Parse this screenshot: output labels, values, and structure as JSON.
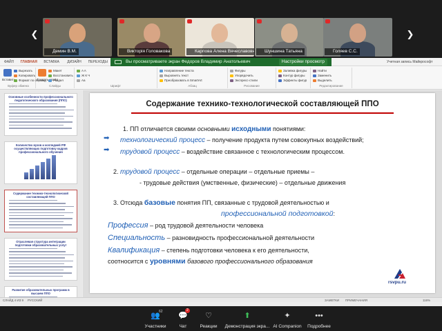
{
  "participants": [
    {
      "name": "Демин В.М.",
      "colors": {
        "bg": "#6e6a5c",
        "skin": "#d9a27a",
        "shirt": "#4a6b8c"
      }
    },
    {
      "name": "Викторія Головакова",
      "colors": {
        "bg": "#9a8a66",
        "skin": "#d8a585",
        "shirt": "#5a3c3c"
      }
    },
    {
      "name": "Карпова Алена Вячеславовна",
      "colors": {
        "bg": "#ece6da",
        "skin": "#e3b899",
        "shirt": "#c9c4bb"
      }
    },
    {
      "name": "Шуншина Татьяна",
      "colors": {
        "bg": "#8c8f86",
        "skin": "#d7b293",
        "shirt": "#6c6f70"
      }
    },
    {
      "name": "Голяев С.С.",
      "colors": {
        "bg": "#7b7f7d",
        "skin": "#d2a184",
        "shirt": "#3d4a5c"
      }
    }
  ],
  "share_banner": {
    "text": "Вы просматриваете экран Федоров Владимир Анатольевич",
    "options_label": "Настройки просмотр"
  },
  "ribbon": {
    "tabs": [
      "ФАЙЛ",
      "ГЛАВНАЯ",
      "ВСТАВКА",
      "ДИЗАЙН",
      "ПЕРЕХОДЫ",
      "АНИМАЦИЯ",
      "ПОКАЗ СЛАЙДОВ",
      "РЕЦЕНЗИРОВАНИЕ",
      "ВИД",
      "ФОРМАТ"
    ],
    "user": "Учетная запись Майкрософт",
    "groups": [
      {
        "label": "Буфер обмена",
        "items": [
          "Вырезать",
          "Копировать",
          "Формат по образцу"
        ],
        "big": "Вставить"
      },
      {
        "label": "Слайды",
        "items": [
          "Макет",
          "Восстановить",
          "Раздел"
        ],
        "big": "Создать слайд"
      },
      {
        "label": "Шрифт",
        "items": [
          "A A",
          "Ж К Ч",
          "Aa"
        ]
      },
      {
        "label": "Абзац",
        "items": [
          "Направление текста",
          "Выровнять текст",
          "Преобразовать в SmartArt"
        ]
      },
      {
        "label": "Рисование",
        "items": [
          "Фигуры",
          "Упорядочить",
          "Экспресс-стили"
        ]
      },
      {
        "label": "",
        "items": [
          "Заливка фигуры",
          "Контур фигуры",
          "Эффекты фигур"
        ]
      },
      {
        "label": "Редактирование",
        "items": [
          "Найти",
          "Заменить",
          "Выделить"
        ]
      }
    ]
  },
  "thumbnails": [
    {
      "title": "Основные особенности профессионального педагогического образования (ППО)",
      "lines": 9
    },
    {
      "title": "Количество вузов и колледжей РФ осуществляющих подготовку кадров профессионального обучения",
      "lines": 0,
      "chart": true
    },
    {
      "title": "Содержание технико-технологической составляющей ППО",
      "lines": 10,
      "selected": true
    },
    {
      "title": "Отраслевая структура интеграции подготовки образовательных услуг",
      "lines": 10
    },
    {
      "title": "Развитие образовательных программ в высшем ППО",
      "lines": 2
    }
  ],
  "slide": {
    "title": "Содержание технико-технологической составляющей ППО",
    "p1_a": "1. ПП отличается своими ",
    "p1_b": "основными",
    "p1_c": "исходными",
    "p1_d": " понятиями:",
    "p1_l1_a": "технологический процесс",
    "p1_l1_b": " – получение продукта путем совокупных воздействий;",
    "p1_l2_a": "трудовой процесс",
    "p1_l2_b": " – воздействие связанное с технологическим процессом.",
    "p2_a": "2. ",
    "p2_b": "трудовой процесс",
    "p2_c": " – отдельные операции – отдельные приемы –",
    "p2_l2": "- трудовые действия (умственные, физические) – отдельные движения",
    "p3_a": "3. Отсюда ",
    "p3_b": "базовые",
    "p3_c": " понятия ПП, связанные с трудовой деятельностью и",
    "p3_d": "профессиональной подготовкой",
    "p3_e": ":",
    "def1_a": "Профессия",
    "def1_b": " – род трудовой деятельности человека",
    "def2_a": "Специальность",
    "def2_b": " – разновидность профессиональной деятельности",
    "def3_a": "Квалификация",
    "def3_b": " – степень подготовки человека к его деятельности,",
    "def3_l2_a": "соотносится с ",
    "def3_l2_b": "уровнями",
    "def3_l2_c": " базового профессионального образования",
    "logo_text": "rsvpu.ru"
  },
  "status_bar": {
    "slide": "СЛАЙД 4 ИЗ 9",
    "lang": "РУССКИЙ",
    "notes": "ЗАМЕТКИ",
    "comments": "ПРИМЕЧАНИЯ",
    "zoom": "116%"
  },
  "zoom_toolbar": {
    "participants_label": "Участники",
    "participants_count": "62",
    "chat_label": "Чат",
    "chat_badge": "2",
    "reactions_label": "Реакции",
    "share_label": "Демонстрация экра...",
    "ai_label": "AI Companion",
    "more_label": "Подробнее"
  }
}
